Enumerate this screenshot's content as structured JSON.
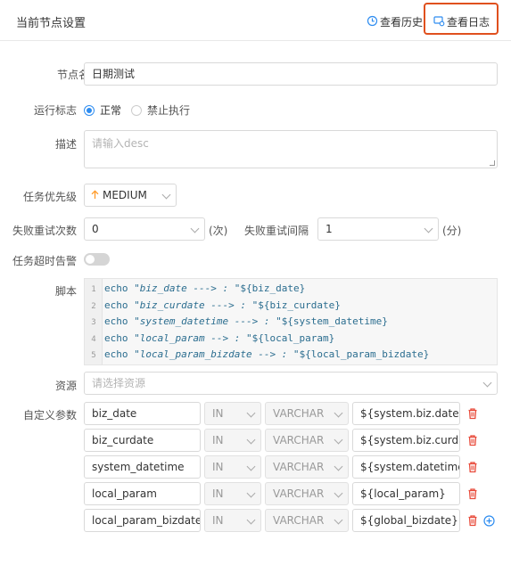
{
  "header": {
    "title": "当前节点设置",
    "history_label": "查看历史",
    "log_label": "查看日志",
    "highlight_color": "#e0501e"
  },
  "form": {
    "node_name_label": "节点名称",
    "node_name_value": "日期测试",
    "run_flag_label": "运行标志",
    "run_flag_options": [
      "正常",
      "禁止执行"
    ],
    "run_flag_selected": "正常",
    "desc_label": "描述",
    "desc_placeholder": "请输入desc",
    "priority_label": "任务优先级",
    "priority_value": "MEDIUM",
    "priority_color": "#ff9b29",
    "retry_label": "失败重试次数",
    "retry_value": "0",
    "retry_unit": "(次)",
    "retry_interval_label": "失败重试间隔",
    "retry_interval_value": "1",
    "retry_interval_unit": "(分)",
    "timeout_label": "任务超时告警",
    "timeout_enabled": false,
    "script_label": "脚本",
    "resource_label": "资源",
    "resource_placeholder": "请选择资源",
    "params_label": "自定义参数"
  },
  "script": [
    {
      "n": "1",
      "kw": "echo",
      "str": " \"biz_date ---> : \"",
      "var": "${biz_date}"
    },
    {
      "n": "2",
      "kw": "echo",
      "str": " \"biz_curdate ---> : \"",
      "var": "${biz_curdate}"
    },
    {
      "n": "3",
      "kw": "echo",
      "str": " \"system_datetime ---> : \"",
      "var": "${system_datetime}"
    },
    {
      "n": "4",
      "kw": "echo",
      "str": " \"local_param --> : \"",
      "var": "${local_param}"
    },
    {
      "n": "5",
      "kw": "echo",
      "str": " \"local_param_bizdate --> : \"",
      "var": "${local_param_bizdate}"
    }
  ],
  "params": [
    {
      "name": "biz_date",
      "direct": "IN",
      "type": "VARCHAR",
      "value": "${system.biz.date}"
    },
    {
      "name": "biz_curdate",
      "direct": "IN",
      "type": "VARCHAR",
      "value": "${system.biz.curdate}"
    },
    {
      "name": "system_datetime",
      "direct": "IN",
      "type": "VARCHAR",
      "value": "${system.datetime}"
    },
    {
      "name": "local_param",
      "direct": "IN",
      "type": "VARCHAR",
      "value": "${local_param}"
    },
    {
      "name": "local_param_bizdate",
      "direct": "IN",
      "type": "VARCHAR",
      "value": "${global_bizdate}"
    }
  ],
  "icons": {
    "history": "history-icon",
    "log": "log-icon",
    "delete": "trash-icon",
    "add": "plus-circle-icon",
    "delete_color": "#e84a3a",
    "add_color": "#2d8cf0"
  }
}
